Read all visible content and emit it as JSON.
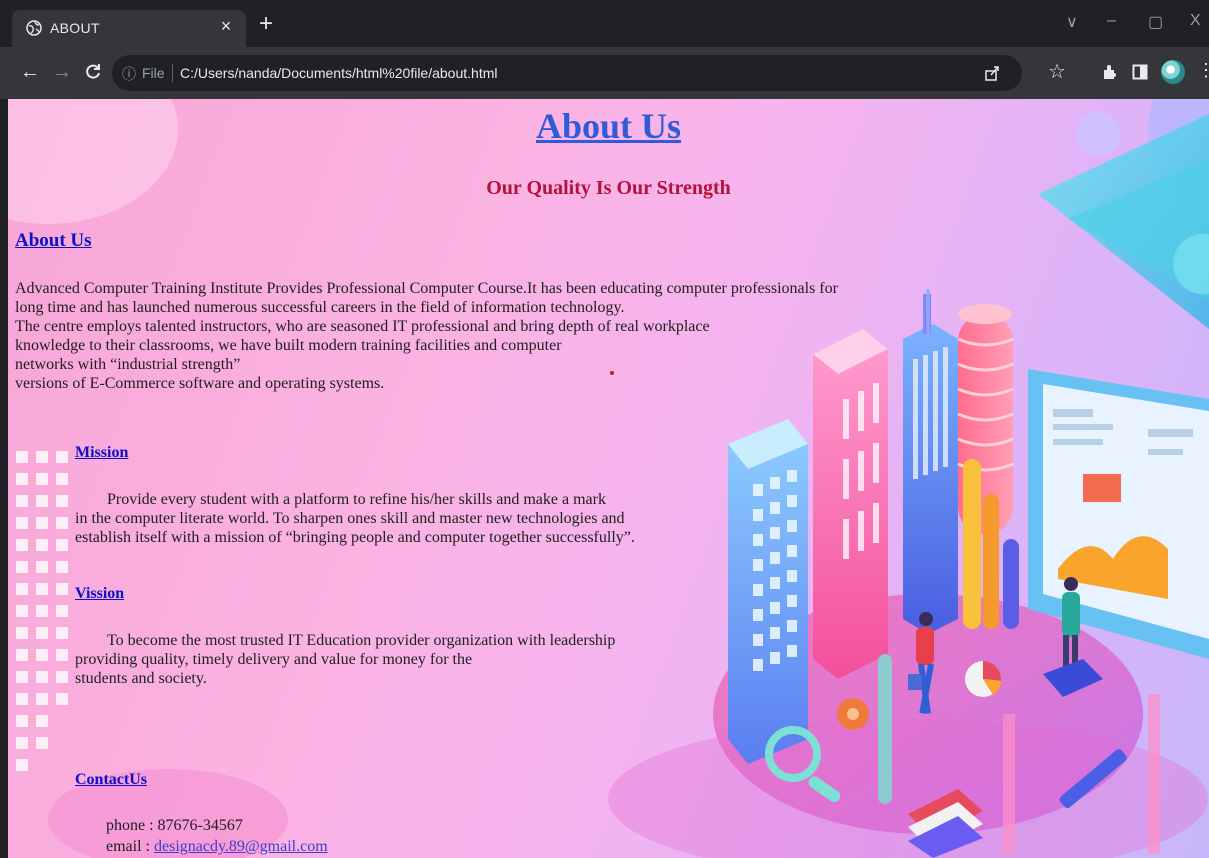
{
  "browser": {
    "tab_title": "ABOUT",
    "tab_close": "×",
    "new_tab": "+",
    "url_info": "ⓘ",
    "url_scheme": "File",
    "url": "C:/Users/nanda/Documents/html%20file/about.html",
    "window_controls": {
      "dropdown": "∨",
      "minimize": "–",
      "restore": "▢",
      "close": "X"
    }
  },
  "page": {
    "title": "About Us",
    "subtitle": "Our Quality Is Our Strength",
    "about": {
      "heading": "About Us",
      "lines": [
        "Advanced Computer Training Institute Provides Professional Computer Course.It has been educating computer professionals for",
        "long time  and has launched numerous successful careers in the field of information technology.",
        "The centre employs talented instructors, who are seasoned IT professional and bring depth of real workplace",
        "knowledge to their classrooms, we have built modern training facilities and computer",
        "networks with “industrial strength”",
        "versions of E-Commerce software and operating systems."
      ]
    },
    "mission": {
      "heading": "Mission",
      "lines": [
        "Provide every student with a platform to refine his/her skills and make a mark",
        "in the computer literate world. To sharpen ones skill and master new technologies and",
        "establish itself with a mission of “bringing people and computer together successfully”."
      ]
    },
    "vision": {
      "heading": "Vission",
      "lines": [
        "To become the most trusted IT Education provider organization with leadership",
        "providing  quality, timely delivery and value for money for the",
        "students and society."
      ]
    },
    "contact": {
      "heading": "ContactUs",
      "phone_label": "phone : 87676-34567",
      "email_label": "email : ",
      "email": "designacdy.89@gmail.com"
    }
  },
  "colors": {
    "title_link": "#2f5bd6",
    "subtitle": "#b3123c",
    "section_link": "#0b10c9"
  }
}
